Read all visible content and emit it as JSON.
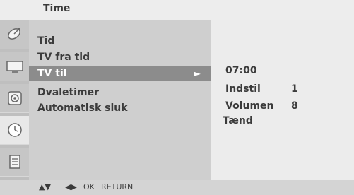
{
  "title": "Time",
  "menu": [
    {
      "label": "Tid"
    },
    {
      "label": "TV fra tid"
    },
    {
      "label": "TV til",
      "arrow": "►"
    },
    {
      "label": "Dvaletimer"
    },
    {
      "label": "Automatisk sluk"
    }
  ],
  "submenu": {
    "time": "07:00",
    "indstil_label": "Indstil",
    "indstil_value": "1",
    "volumen_label": "Volumen",
    "volumen_value": "8",
    "taend": "Tænd"
  },
  "icons": [
    "satellite-dish-icon",
    "screen-picture-icon",
    "speaker-audio-icon",
    "clock-icon",
    "options-menu-icon"
  ],
  "help": {
    "updown": "▲▼",
    "leftright": "◀▶",
    "ok": "OK",
    "return": "RETURN"
  }
}
